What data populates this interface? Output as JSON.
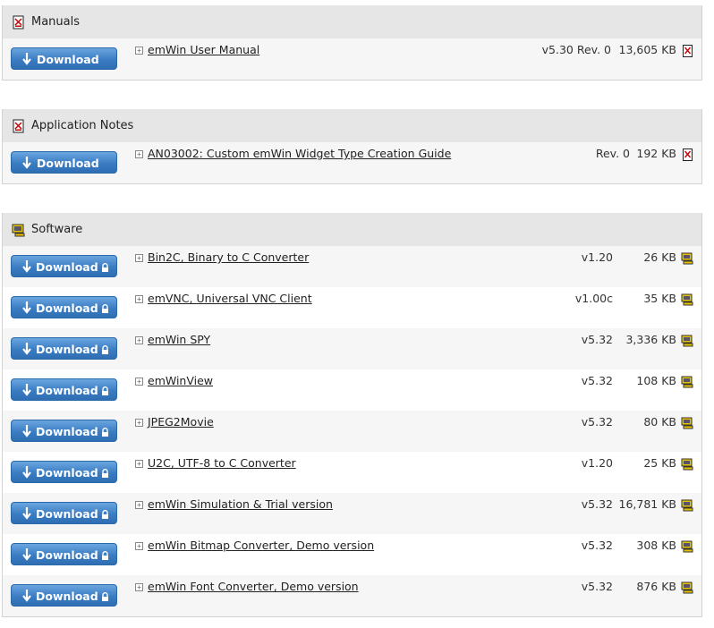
{
  "download_label": "Download",
  "sections": {
    "manuals": {
      "title": "Manuals",
      "rows": [
        {
          "name": "emWin User Manual",
          "version": "v5.30 Rev. 0",
          "size": "13,605 KB"
        }
      ]
    },
    "appnotes": {
      "title": "Application Notes",
      "rows": [
        {
          "name": "AN03002: Custom emWin Widget Type Creation Guide",
          "version": "Rev. 0",
          "size": "192 KB"
        }
      ]
    },
    "software": {
      "title": "Software",
      "rows": [
        {
          "name": "Bin2C, Binary to C Converter",
          "version": "v1.20",
          "size": "26 KB"
        },
        {
          "name": "emVNC, Universal VNC Client",
          "version": "v1.00c",
          "size": "35 KB"
        },
        {
          "name": "emWin SPY",
          "version": "v5.32",
          "size": "3,336 KB"
        },
        {
          "name": "emWinView",
          "version": "v5.32",
          "size": "108 KB"
        },
        {
          "name": "JPEG2Movie",
          "version": "v5.32",
          "size": "80 KB"
        },
        {
          "name": "U2C, UTF-8 to C Converter",
          "version": "v1.20",
          "size": "25 KB"
        },
        {
          "name": "emWin Simulation & Trial version",
          "version": "v5.32",
          "size": "16,781 KB"
        },
        {
          "name": "emWin Bitmap Converter, Demo version",
          "version": "v5.32",
          "size": "308 KB"
        },
        {
          "name": "emWin Font Converter, Demo version",
          "version": "v5.32",
          "size": "876 KB"
        }
      ]
    }
  },
  "colors": {
    "header_bg": "#e6e6e6",
    "row_bg": "#f6f6f6",
    "button_blue": "#3b7cc2"
  },
  "icons": {
    "pdf": "pdf-icon",
    "software": "software-icon",
    "download_arrow": "download-arrow-icon",
    "lock": "lock-icon",
    "expand": "expand-icon"
  }
}
